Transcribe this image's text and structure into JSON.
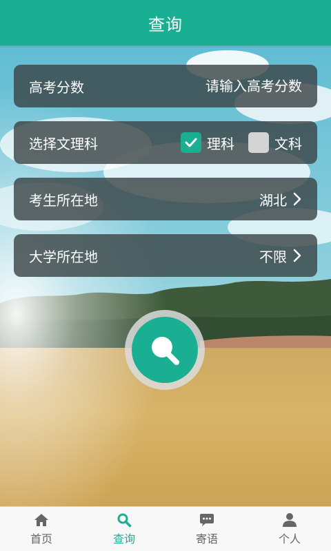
{
  "header": {
    "title": "查询"
  },
  "form": {
    "score": {
      "label": "高考分数",
      "placeholder": "请输入高考分数",
      "value": ""
    },
    "subject": {
      "label": "选择文理科",
      "options": [
        {
          "label": "理科",
          "checked": true
        },
        {
          "label": "文科",
          "checked": false
        }
      ]
    },
    "origin": {
      "label": "考生所在地",
      "value": "湖北"
    },
    "university": {
      "label": "大学所在地",
      "value": "不限"
    }
  },
  "search": {
    "icon": "search-icon"
  },
  "nav": {
    "items": [
      {
        "label": "首页",
        "icon": "home-icon",
        "active": false
      },
      {
        "label": "查询",
        "icon": "search-icon",
        "active": true
      },
      {
        "label": "寄语",
        "icon": "chat-icon",
        "active": false
      },
      {
        "label": "个人",
        "icon": "person-icon",
        "active": false
      }
    ]
  },
  "colors": {
    "accent": "#1aaf93",
    "row_bg": "#3a4244",
    "nav_bg": "#f8f8f8",
    "inactive_text": "#666666"
  }
}
